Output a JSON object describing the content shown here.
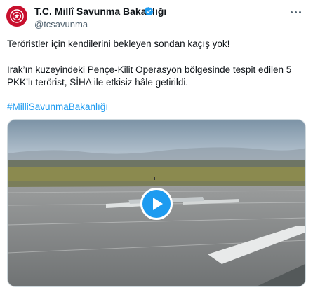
{
  "author": {
    "display_name": "T.C. Millî Savunma Bakanlığı",
    "handle": "@tcsavunma",
    "verified": true
  },
  "tweet": {
    "line1": "Teröristler için kendilerini bekleyen sondan kaçış yok!",
    "line2": "Irak’ın kuzeyindeki Pençe-Kilit Operasyon bölgesinde tespit edilen 5",
    "line3": "PKK’lı terörist, SİHA ile etkisiz hâle getirildi.",
    "hashtag": "#MilliSavunmaBakanlığı"
  },
  "media": {
    "type": "video",
    "play_icon": "play-icon"
  },
  "colors": {
    "link": "#1d9bf0",
    "avatar_bg": "#c8102e",
    "verified": "#1d9bf0"
  }
}
